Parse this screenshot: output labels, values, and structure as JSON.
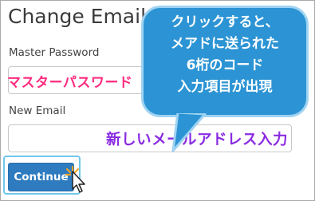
{
  "form": {
    "title": "Change Email",
    "master_password_label": "Master Password",
    "new_email_label": "New Email",
    "continue_label": "Continue"
  },
  "annotations": {
    "password_hint": "マスターパスワード",
    "email_hint": "新しいメールアドレス入力",
    "callout_lines": [
      "クリックすると、",
      "メアドに送られた",
      "6桁のコード",
      "入力項目が出現"
    ]
  },
  "icons": {
    "cursor": "mouse-pointer-icon",
    "click": "click-burst-icon"
  },
  "colors": {
    "callout_fill": "#2c94d4",
    "callout_border": "#9fd3f2",
    "button": "#2e7bbf",
    "password_hint": "#ff2b7f",
    "email_hint": "#8a2be2"
  }
}
